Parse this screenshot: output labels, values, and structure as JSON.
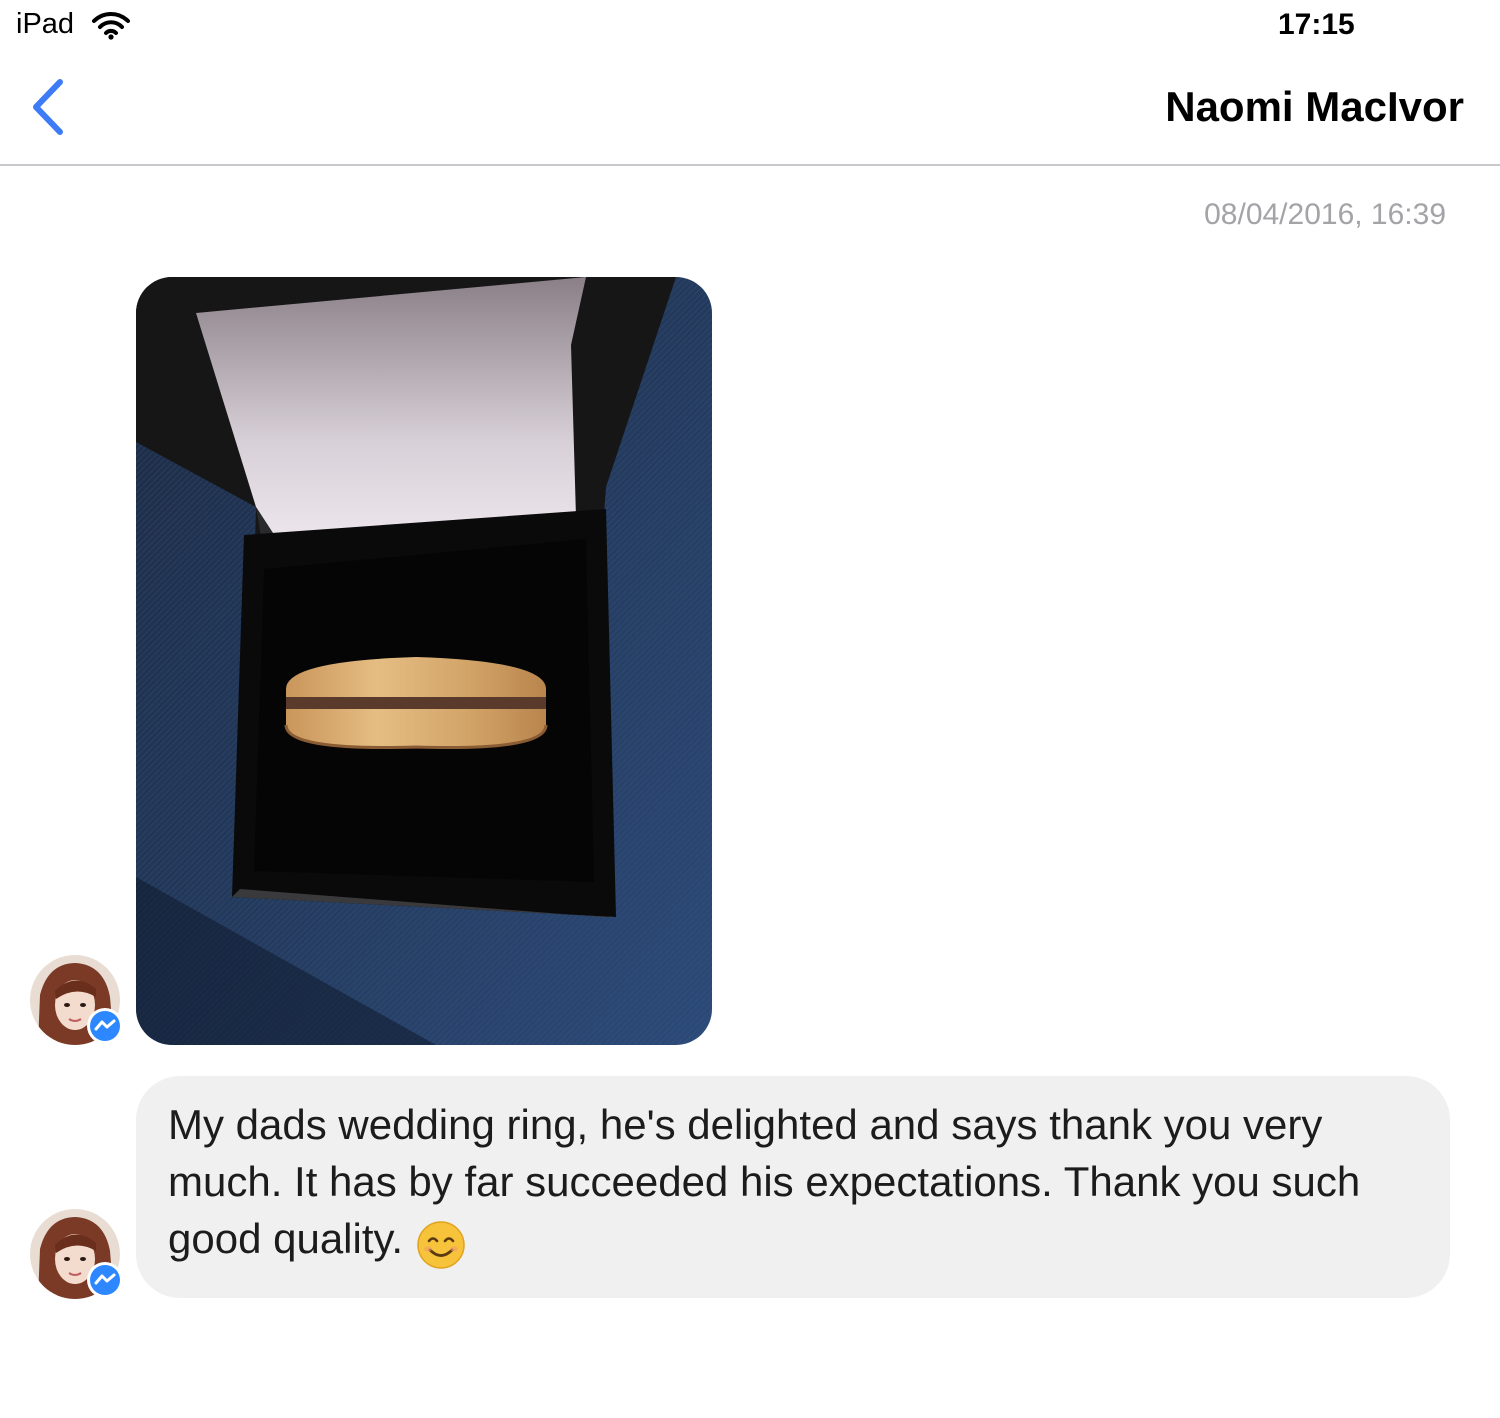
{
  "status_bar": {
    "device": "iPad",
    "wifi_icon": "wifi-icon",
    "time": "17:15"
  },
  "nav": {
    "back_icon": "chevron-left-icon",
    "title": "Naomi MacIvor"
  },
  "conversation": {
    "timestamp": "08/04/2016, 16:39",
    "messages": [
      {
        "type": "photo",
        "sender_avatar": "avatar"
      },
      {
        "type": "text",
        "sender_avatar": "avatar",
        "text": "My dads wedding ring, he's delighted and says thank you very much. It has by far succeeded his expectations. Thank you such good quality.",
        "emoji": "smiling-face-emoji"
      }
    ]
  },
  "colors": {
    "accent": "#3e7bf6",
    "bubble": "#f0f0f0",
    "timestamp": "#a3a3a8",
    "messenger_badge": "#2d88ff"
  }
}
